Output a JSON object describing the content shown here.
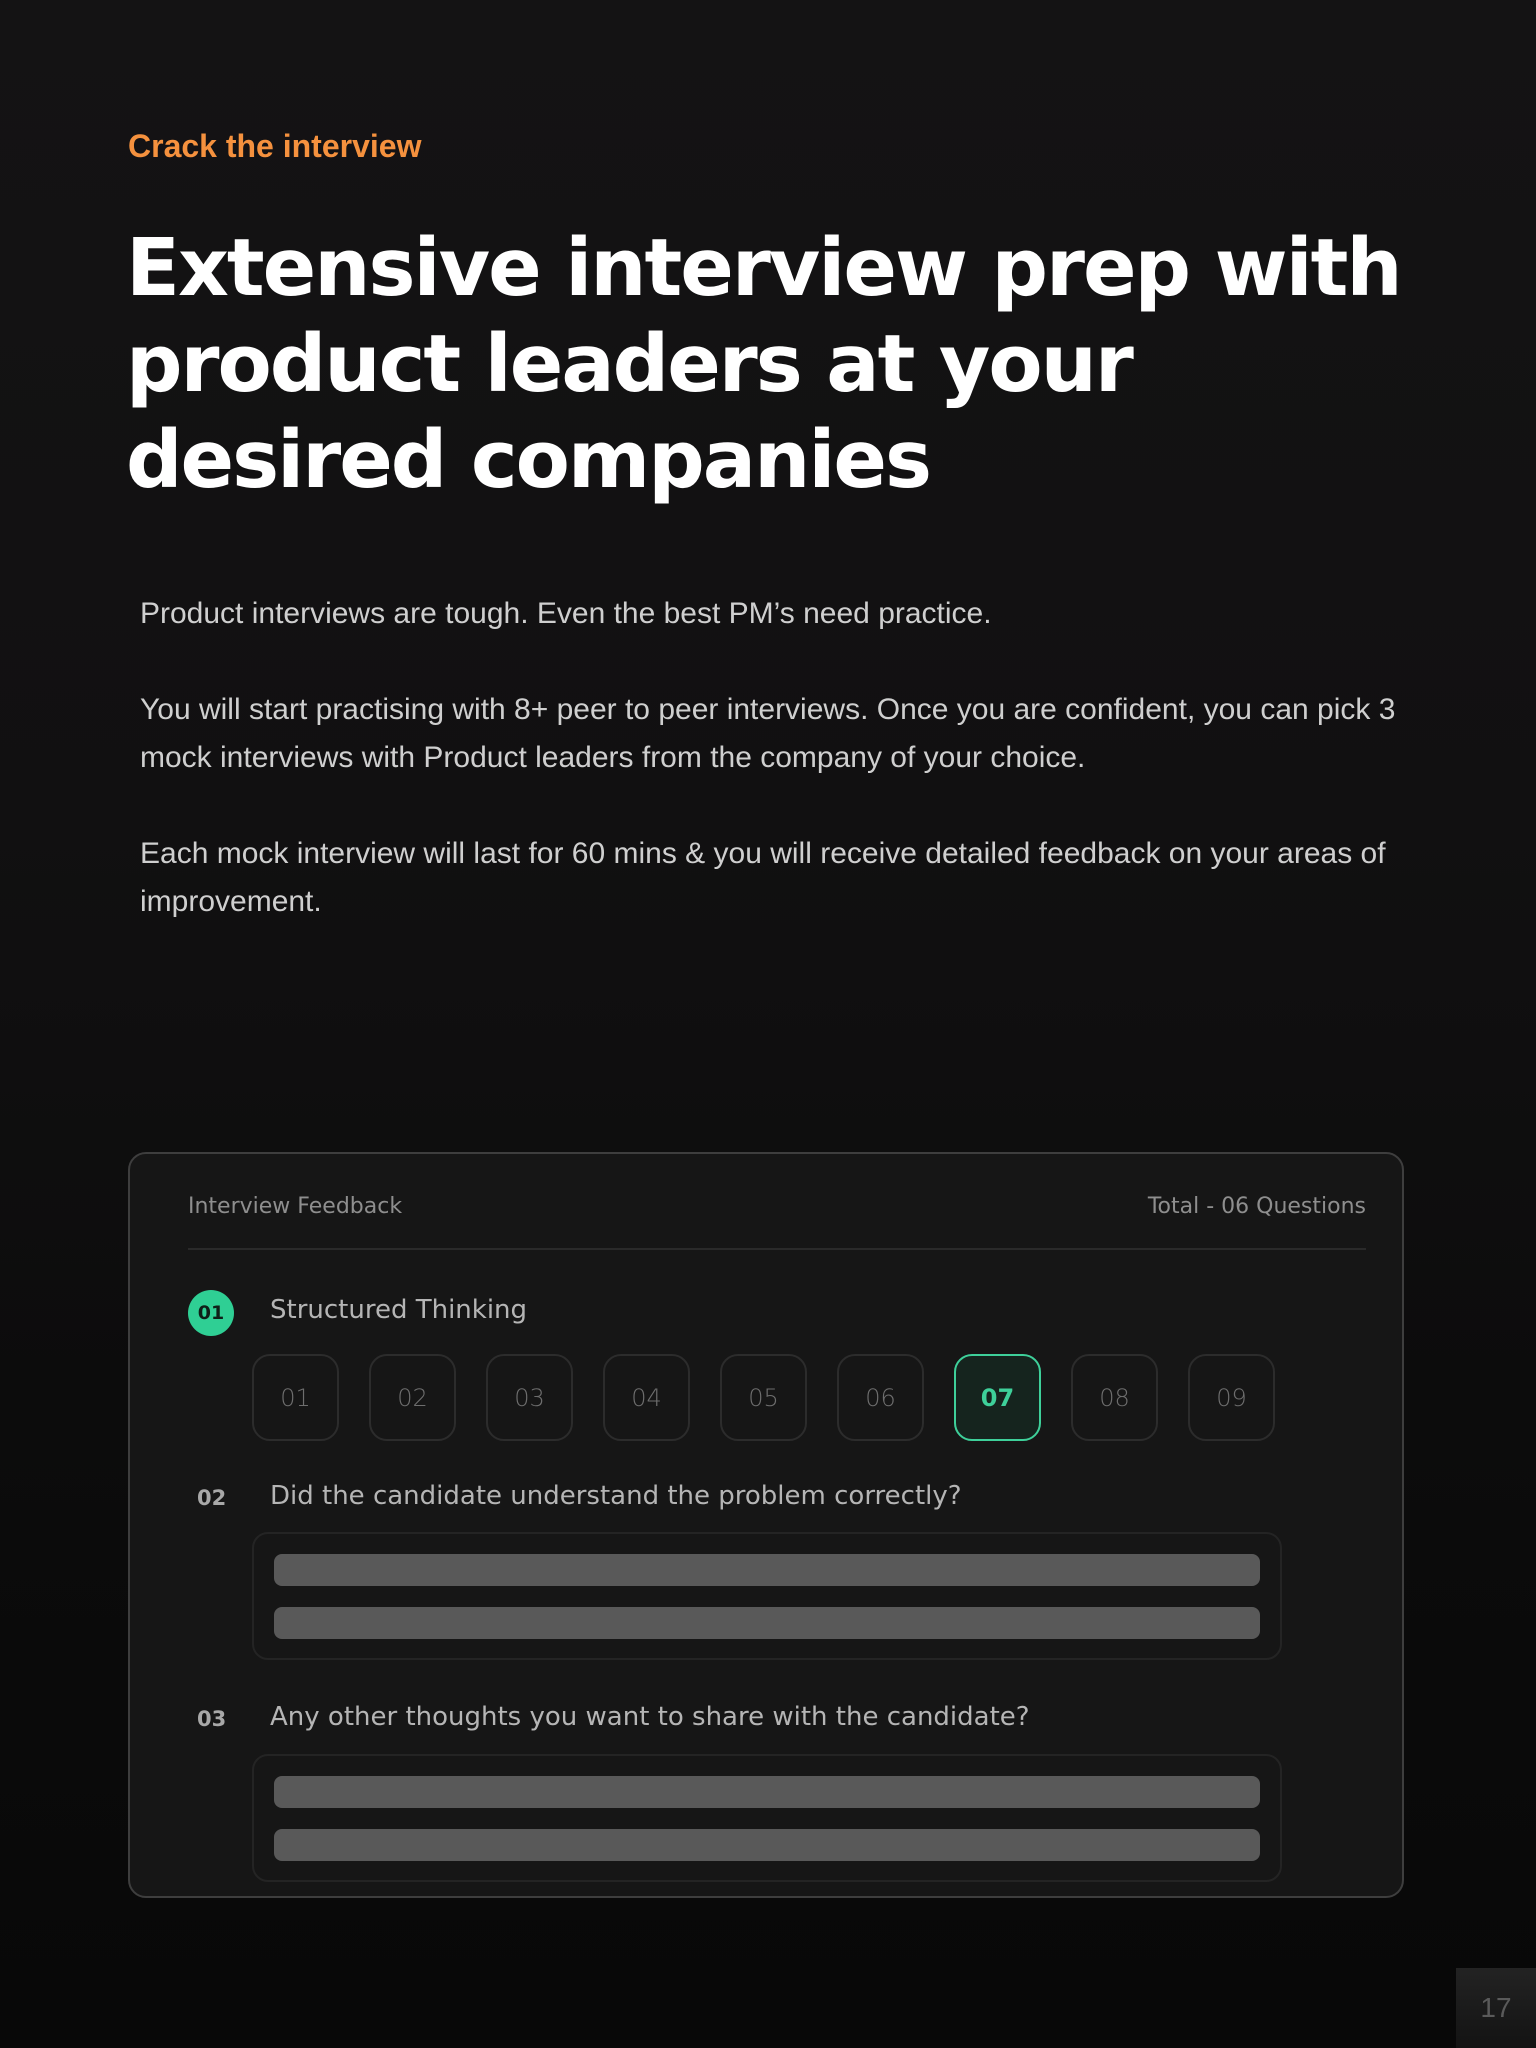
{
  "eyebrow": "Crack the interview",
  "headline": "Extensive interview prep with product leaders at your desired companies",
  "body": {
    "paragraphs": [
      "Product interviews are tough. Even the best PM’s need practice.",
      "You will start practising with 8+ peer to peer interviews. Once you are confident, you can pick 3 mock interviews with Product leaders from the company of your choice.",
      "Each mock interview will last for 60 mins & you will receive detailed feedback on your areas of improvement."
    ]
  },
  "card": {
    "title": "Interview Feedback",
    "total": "Total - 06 Questions",
    "questions": [
      {
        "number": "01",
        "title": "Structured Thinking",
        "ratings": [
          "01",
          "02",
          "03",
          "04",
          "05",
          "06",
          "07",
          "08",
          "09"
        ],
        "selected_rating": "07"
      },
      {
        "number": "02",
        "title": "Did the candidate understand the problem correctly?"
      },
      {
        "number": "03",
        "title": "Any other thoughts you want to share with the candidate?"
      }
    ]
  },
  "colors": {
    "accent_orange": "#f5913e",
    "accent_green": "#2fcf94"
  },
  "page_number": "17"
}
